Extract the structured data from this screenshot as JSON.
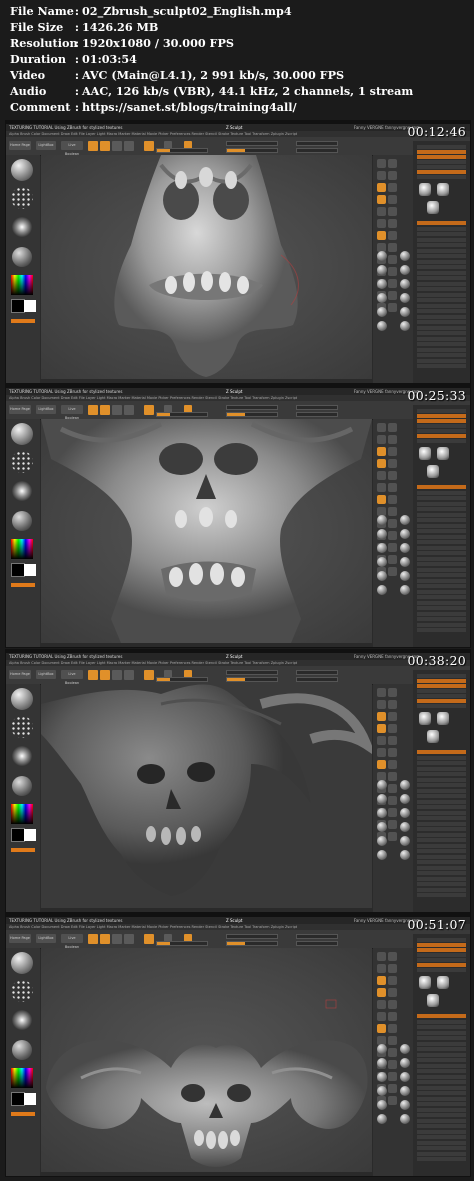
{
  "file_info": {
    "rows": [
      {
        "label": "File Name",
        "value": "02_Zbrush_sculpt02_English.mp4"
      },
      {
        "label": "File Size",
        "value": "1426.26 MB"
      },
      {
        "label": "Resolution",
        "value": "1920x1080 / 30.000 FPS"
      },
      {
        "label": "Duration",
        "value": "01:03:54"
      },
      {
        "label": "Video",
        "value": "AVC (Main@L4.1), 2 991 kb/s, 30.000 FPS"
      },
      {
        "label": "Audio",
        "value": "AAC, 126 kb/s (VBR), 44.1 kHz, 2 channels, 1 stream"
      },
      {
        "label": "Comment",
        "value": "https://sanet.st/blogs/training4all/"
      }
    ]
  },
  "app": {
    "title_left": "TEXTURING TUTORIAL  Using ZBrush for stylized textures",
    "title_center": "Z  Sculpt",
    "title_right": "Fanny VERGNE  fannyvergne.com",
    "menu": "Alpha  Brush  Color  Document  Draw  Edit  File  Layer  Light  Macro  Marker  Material  Movie  Picker  Preferences  Render  Stencil  Stroke  Texture  Tool  Transform  Zplugin  Zscript",
    "buttons": {
      "home": "Home Page",
      "lightbox": "LightBox",
      "live_boolean": "Live Boolean"
    }
  },
  "frames": [
    {
      "timestamp": "00:12:46"
    },
    {
      "timestamp": "00:25:33"
    },
    {
      "timestamp": "00:38:20"
    },
    {
      "timestamp": "00:51:07"
    }
  ],
  "accent_color": "#e0902a"
}
